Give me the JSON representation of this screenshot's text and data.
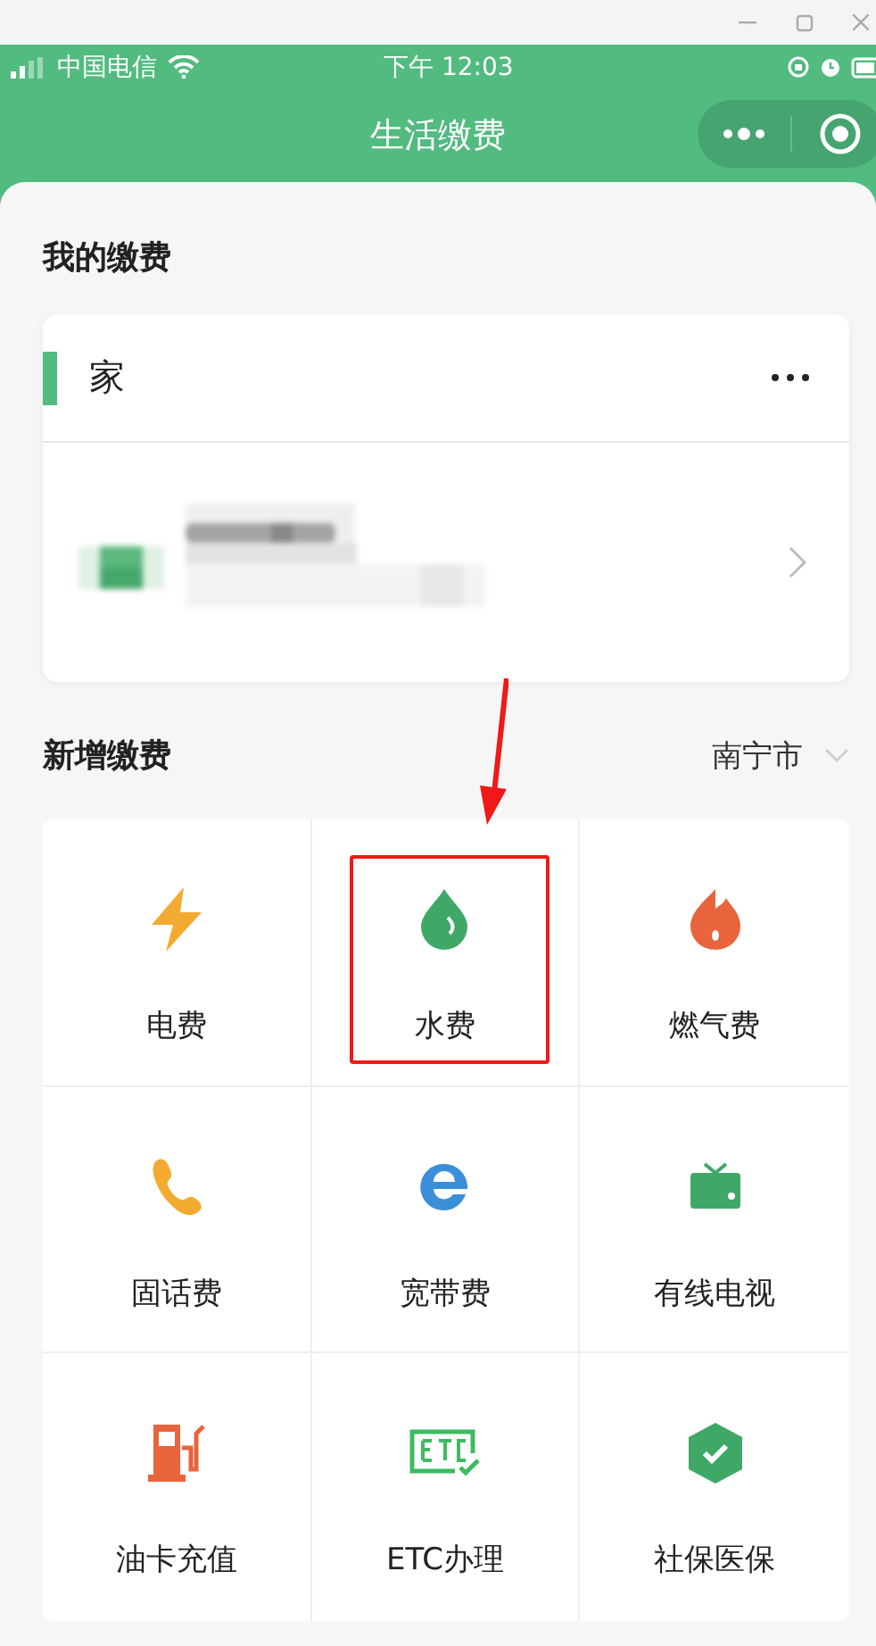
{
  "status_bar": {
    "carrier": "中国电信",
    "time": "下午 12:03"
  },
  "nav": {
    "title": "生活缴费"
  },
  "my_bills": {
    "title": "我的缴费",
    "group": {
      "name": "家"
    }
  },
  "new_bill": {
    "title": "新增缴费",
    "city": "南宁市",
    "items": [
      {
        "label": "电费",
        "highlighted": false
      },
      {
        "label": "水费",
        "highlighted": true
      },
      {
        "label": "燃气费",
        "highlighted": false
      },
      {
        "label": "固话费",
        "highlighted": false
      },
      {
        "label": "宽带费",
        "highlighted": false
      },
      {
        "label": "有线电视",
        "highlighted": false
      },
      {
        "label": "油卡充值",
        "highlighted": false
      },
      {
        "label": "ETC办理",
        "highlighted": false
      },
      {
        "label": "社保医保",
        "highlighted": false
      }
    ]
  }
}
